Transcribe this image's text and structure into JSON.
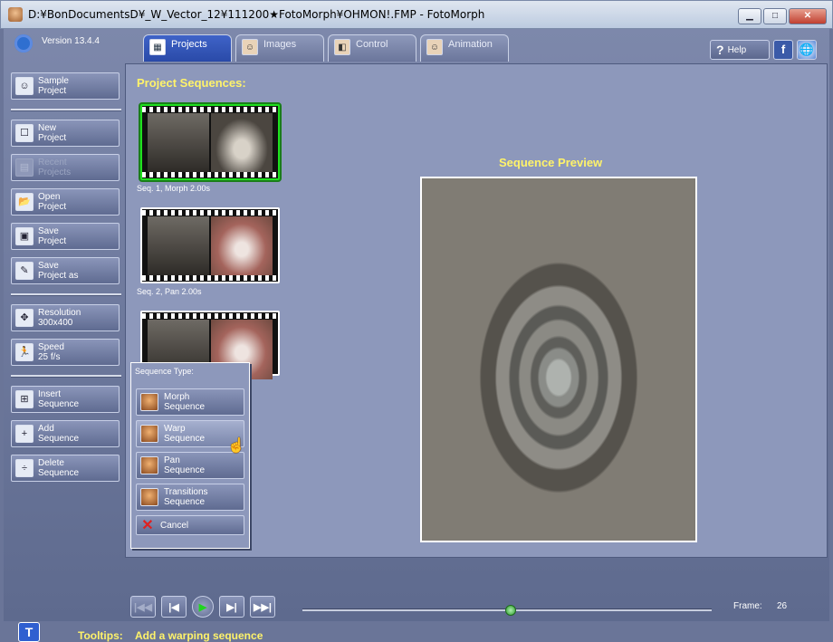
{
  "window": {
    "title": "D:¥BonDocumentsD¥_W_Vector_12¥111200★FotoMorph¥OHMON!.FMP - FotoMorph",
    "min_label": "▁",
    "max_label": "□",
    "close_label": "✕"
  },
  "app": {
    "version": "Version 13.4.4"
  },
  "tabs": [
    {
      "label": "Projects",
      "icon": "grid-icon"
    },
    {
      "label": "Images",
      "icon": "portrait-icon"
    },
    {
      "label": "Control",
      "icon": "control-icon"
    },
    {
      "label": "Animation",
      "icon": "animation-icon"
    }
  ],
  "topright": {
    "help_label": "Help",
    "facebook_label": "f",
    "web_label": "🌐"
  },
  "sidebar": {
    "sample": {
      "line1": "Sample",
      "line2": "Project"
    },
    "new": {
      "line1": "New",
      "line2": "Project"
    },
    "recent": {
      "line1": "Recent",
      "line2": "Projects"
    },
    "open": {
      "line1": "Open",
      "line2": "Project"
    },
    "save": {
      "line1": "Save",
      "line2": "Project"
    },
    "saveas": {
      "line1": "Save",
      "line2": "Project as"
    },
    "resolution": {
      "line1": "Resolution",
      "line2": "300x400"
    },
    "speed": {
      "line1": "Speed",
      "line2": "25 f/s"
    },
    "insert": {
      "line1": "Insert",
      "line2": "Sequence"
    },
    "add": {
      "line1": "Add",
      "line2": "Sequence"
    },
    "delete": {
      "line1": "Delete",
      "line2": "Sequence"
    }
  },
  "main": {
    "title": "Project Sequences:",
    "sequences": [
      {
        "caption": "Seq. 1,  Morph 2.00s"
      },
      {
        "caption": "Seq. 2,  Pan 2.00s"
      }
    ],
    "preview_title": "Sequence Preview"
  },
  "popup": {
    "title": "Sequence Type:",
    "morph": {
      "line1": "Morph",
      "line2": "Sequence"
    },
    "warp": {
      "line1": "Warp",
      "line2": "Sequence"
    },
    "pan": {
      "line1": "Pan",
      "line2": "Sequence"
    },
    "transitions": {
      "line1": "Transitions",
      "line2": "Sequence"
    },
    "cancel": "Cancel"
  },
  "transport": {
    "first": "|◀◀",
    "prev": "|◀",
    "play": "▶",
    "next": "▶|",
    "last": "▶▶|",
    "position": 0.51
  },
  "frame": {
    "label": "Frame:",
    "value": "26"
  },
  "tooltips": {
    "label": "Tooltips:",
    "text": "Add a warping sequence",
    "toggle": "T"
  }
}
